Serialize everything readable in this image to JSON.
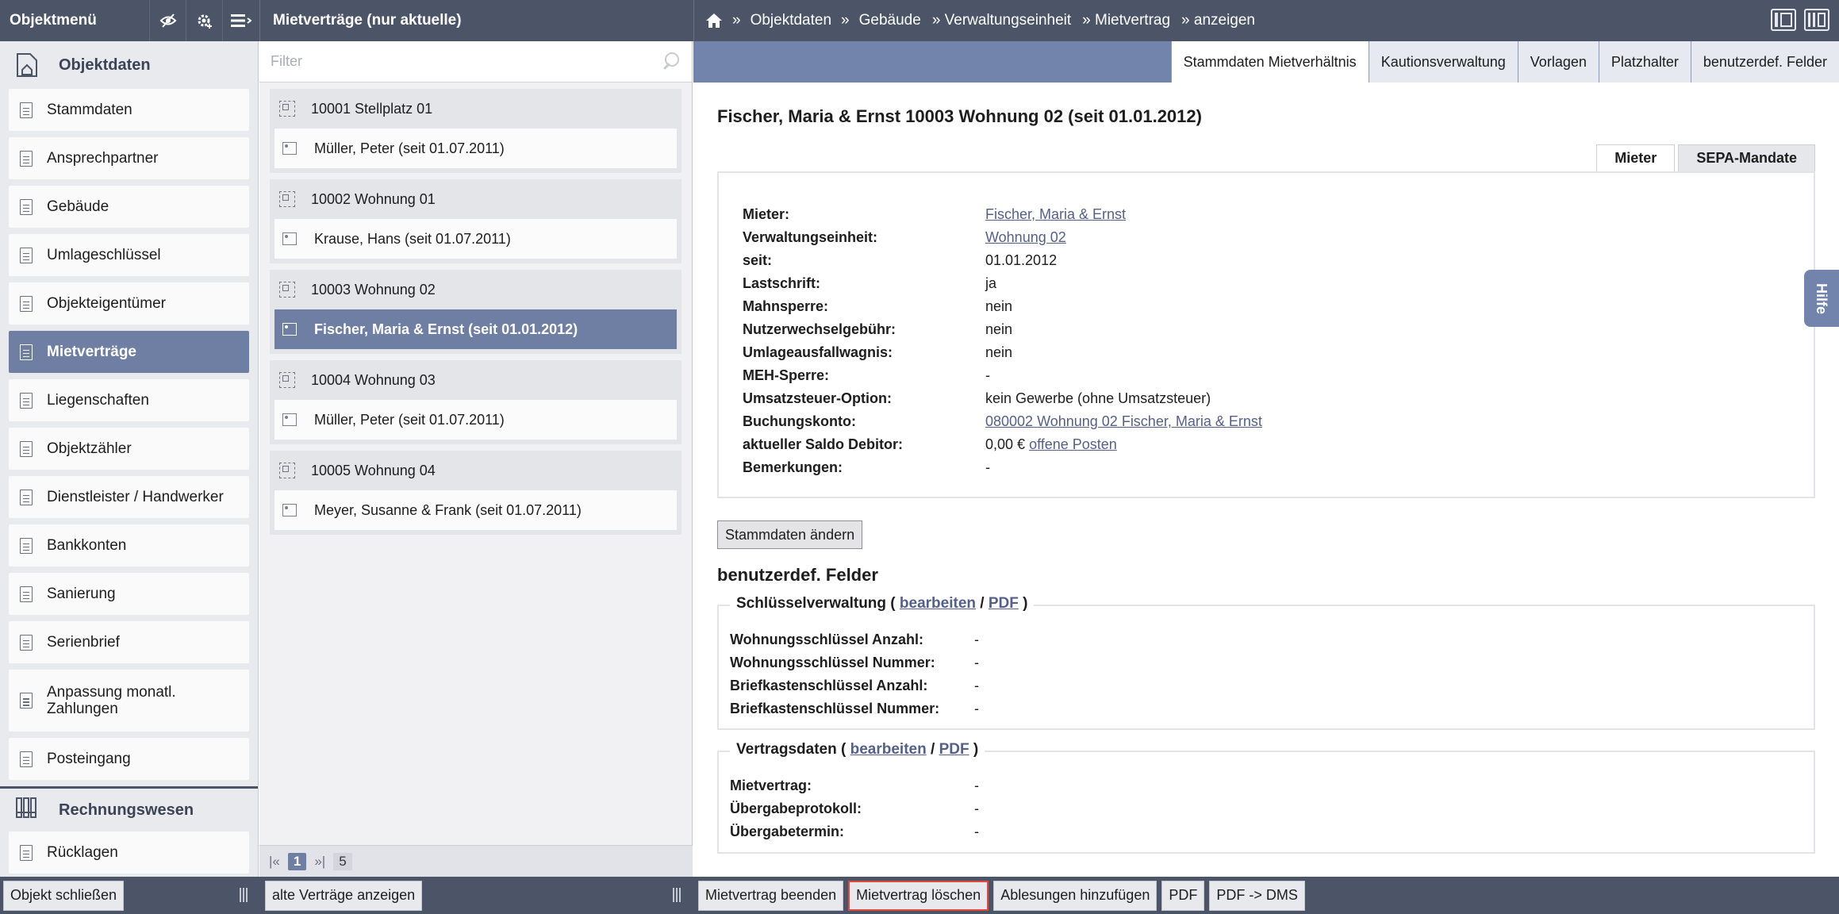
{
  "topbar": {
    "left_title": "Objektmenü",
    "mid_title": "Mietverträge (nur aktuelle)",
    "breadcrumbs": [
      {
        "label": "Objektdaten"
      },
      {
        "label": "Gebäude"
      },
      {
        "label": "» Verwaltungseinheit"
      },
      {
        "label": "» Mietvertrag"
      },
      {
        "label": "» anzeigen"
      }
    ],
    "crumb_sep": "»"
  },
  "sidebar": {
    "section1": "Objektdaten",
    "items": [
      {
        "label": "Stammdaten"
      },
      {
        "label": "Ansprechpartner"
      },
      {
        "label": "Gebäude"
      },
      {
        "label": "Umlageschlüssel"
      },
      {
        "label": "Objekteigentümer"
      },
      {
        "label": "Mietverträge"
      },
      {
        "label": "Liegenschaften"
      },
      {
        "label": "Objektzähler"
      },
      {
        "label": "Dienstleister / Handwerker"
      },
      {
        "label": "Bankkonten"
      },
      {
        "label": "Sanierung"
      },
      {
        "label": "Serienbrief"
      },
      {
        "label": "Anpassung monatl. Zahlungen"
      },
      {
        "label": "Posteingang"
      }
    ],
    "section2": "Rechnungswesen",
    "items2": [
      {
        "label": "Rücklagen"
      }
    ]
  },
  "list": {
    "filter_placeholder": "Filter",
    "groups": [
      {
        "unit": "10001 Stellplatz 01",
        "tenant": "Müller, Peter (seit 01.07.2011)"
      },
      {
        "unit": "10002 Wohnung 01",
        "tenant": "Krause, Hans (seit 01.07.2011)"
      },
      {
        "unit": "10003 Wohnung 02",
        "tenant": "Fischer, Maria & Ernst (seit 01.01.2012)"
      },
      {
        "unit": "10004 Wohnung 03",
        "tenant": "Müller, Peter (seit 01.07.2011)"
      },
      {
        "unit": "10005 Wohnung 04",
        "tenant": "Meyer, Susanne & Frank (seit 01.07.2011)"
      }
    ],
    "pager": {
      "first": "|«",
      "current": "1",
      "last": "»|",
      "count": "5"
    }
  },
  "main": {
    "tabs": [
      {
        "label": "Stammdaten Mietverhältnis"
      },
      {
        "label": "Kautionsverwaltung"
      },
      {
        "label": "Vorlagen"
      },
      {
        "label": "Platzhalter"
      },
      {
        "label": "benutzerdef. Felder"
      }
    ],
    "title": "Fischer, Maria & Ernst 10003 Wohnung 02 (seit 01.01.2012)",
    "subtabs": [
      {
        "label": "Mieter"
      },
      {
        "label": "SEPA-Mandate"
      }
    ],
    "details": [
      {
        "key": "Mieter:",
        "value": "Fischer, Maria & Ernst"
      },
      {
        "key": "Verwaltungseinheit:",
        "value": "Wohnung 02"
      },
      {
        "key": "seit:",
        "value": "01.01.2012"
      },
      {
        "key": "Lastschrift:",
        "value": "ja"
      },
      {
        "key": "Mahnsperre:",
        "value": "nein"
      },
      {
        "key": "Nutzerwechselgebühr:",
        "value": "nein"
      },
      {
        "key": "Umlageausfallwagnis:",
        "value": "nein"
      },
      {
        "key": "MEH-Sperre:",
        "value": "-"
      },
      {
        "key": "Umsatzsteuer-Option:",
        "value": "kein Gewerbe (ohne Umsatzsteuer)"
      },
      {
        "key": "Buchungskonto:",
        "value": "080002 Wohnung 02 Fischer, Maria & Ernst"
      },
      {
        "key": "aktueller Saldo Debitor:",
        "value": "0,00 €",
        "link": "offene Posten"
      },
      {
        "key": "Bemerkungen:",
        "value": "-"
      }
    ],
    "edit_button": "Stammdaten ändern",
    "custom_title": "benutzerdef. Felder",
    "fieldset1": {
      "legend": "Schlüsselverwaltung",
      "edit": "bearbeiten",
      "pdf": "PDF",
      "rows": [
        {
          "key": "Wohnungsschlüssel Anzahl:",
          "value": "-"
        },
        {
          "key": "Wohnungsschlüssel Nummer:",
          "value": "-"
        },
        {
          "key": "Briefkastenschlüssel Anzahl:",
          "value": "-"
        },
        {
          "key": "Briefkastenschlüssel Nummer:",
          "value": "-"
        }
      ]
    },
    "fieldset2": {
      "legend": "Vertragsdaten",
      "edit": "bearbeiten",
      "pdf": "PDF",
      "rows": [
        {
          "key": "Mietvertrag:",
          "value": "-"
        },
        {
          "key": "Übergabeprotokoll:",
          "value": "-"
        },
        {
          "key": "Übergabetermin:",
          "value": "-"
        }
      ]
    },
    "help": "Hilfe"
  },
  "bottombar": {
    "left": "Objekt schließen",
    "mid": "alte Verträge anzeigen",
    "right": [
      {
        "label": "Mietvertrag beenden"
      },
      {
        "label": "Mietvertrag löschen"
      },
      {
        "label": "Ablesungen hinzufügen"
      },
      {
        "label": "PDF"
      },
      {
        "label": "PDF -> DMS"
      }
    ]
  },
  "colors": {
    "header": "#4c5568",
    "accent": "#6f7fa3",
    "tabbar": "#7384ac",
    "danger": "#e24a3c",
    "link": "#55608a"
  },
  "icons": {
    "topbar": [
      "eye-slash-icon",
      "gear-plus-icon",
      "list-menu-icon",
      "home-icon",
      "layout-two-col-icon",
      "layout-three-col-icon"
    ],
    "sidebar": [
      "building-icon",
      "document-icon",
      "binder-icon"
    ],
    "list": [
      "unit-icon",
      "person-card-icon",
      "search-icon"
    ]
  }
}
